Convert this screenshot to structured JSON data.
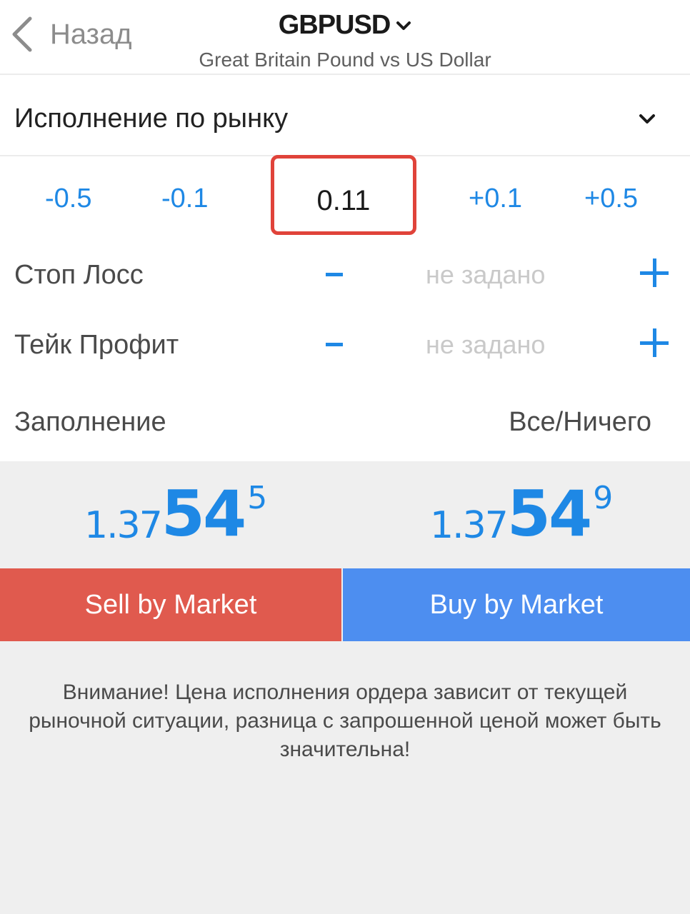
{
  "header": {
    "back_label": "Назад",
    "symbol": "GBPUSD",
    "subtitle": "Great Britain Pound vs US Dollar"
  },
  "execution": {
    "label": "Исполнение по рынку"
  },
  "volume": {
    "steps": [
      "-0.5",
      "-0.1",
      "+0.1",
      "+0.5"
    ],
    "value": "0.11"
  },
  "stop_loss": {
    "label": "Стоп Лосс",
    "placeholder": "не задано"
  },
  "take_profit": {
    "label": "Тейк Профит",
    "placeholder": "не задано"
  },
  "filling": {
    "label": "Заполнение",
    "value": "Все/Ничего"
  },
  "prices": {
    "bid": {
      "small": "1.37",
      "big": "54",
      "sup": "5"
    },
    "ask": {
      "small": "1.37",
      "big": "54",
      "sup": "9"
    }
  },
  "actions": {
    "sell_label": "Sell by Market",
    "buy_label": "Buy by Market"
  },
  "warning": {
    "text": "Внимание! Цена исполнения ордера зависит от текущей рыночной ситуации, разница с запрошенной ценой может быть значительна!"
  },
  "colors": {
    "accent_blue": "#1e88e5",
    "sell_red": "#e05a4e",
    "buy_blue": "#4d8ef0",
    "highlight_red": "#e0433a"
  },
  "icons": {
    "back": "chevron-left-icon",
    "symbol_dropdown": "chevron-down-icon",
    "execution_dropdown": "chevron-down-icon",
    "decrease": "minus-icon",
    "increase": "plus-icon"
  }
}
